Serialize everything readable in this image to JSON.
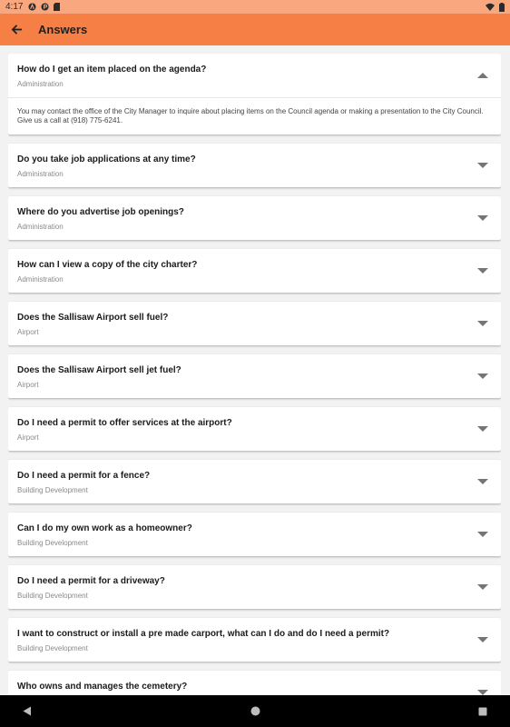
{
  "status_bar": {
    "time": "4:17"
  },
  "app_bar": {
    "title": "Answers"
  },
  "faqs": [
    {
      "question": "How do I get an item placed on the agenda?",
      "category": "Administration",
      "expanded": true,
      "answer": "You may contact the office of the City Manager to inquire about placing items on the Council agenda or making a presentation to the City Council. Give us a call at (918) 775-6241."
    },
    {
      "question": "Do you take job applications at any time?",
      "category": "Administration",
      "expanded": false
    },
    {
      "question": "Where do you advertise job openings?",
      "category": "Administration",
      "expanded": false
    },
    {
      "question": "How can I view a copy of the city charter?",
      "category": "Administration",
      "expanded": false
    },
    {
      "question": "Does the Sallisaw Airport sell fuel?",
      "category": "Airport",
      "expanded": false
    },
    {
      "question": "Does the Sallisaw Airport sell jet fuel?",
      "category": "Airport",
      "expanded": false
    },
    {
      "question": "Do I need a permit to offer services at the airport?",
      "category": "Airport",
      "expanded": false
    },
    {
      "question": "Do I need a permit for a fence?",
      "category": "Building Development",
      "expanded": false
    },
    {
      "question": "Can I do my own work as a homeowner?",
      "category": "Building Development",
      "expanded": false
    },
    {
      "question": "Do I need a permit for a driveway?",
      "category": "Building Development",
      "expanded": false
    },
    {
      "question": "I want to construct or install a pre made carport, what can I do and do I need a permit?",
      "category": "Building Development",
      "expanded": false
    },
    {
      "question": "Who owns and manages the cemetery?",
      "category": "",
      "expanded": false
    }
  ],
  "colors": {
    "app_bar": "#f57f45",
    "status_bar": "#f9a77f",
    "background": "#f2f2f2"
  }
}
